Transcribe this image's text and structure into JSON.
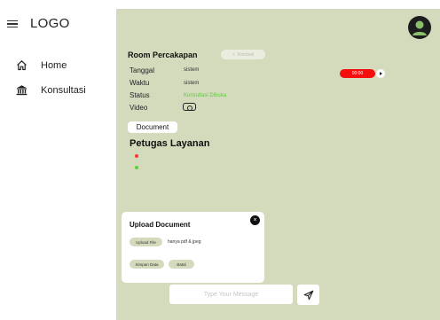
{
  "sidebar": {
    "logo": "LOGO",
    "items": [
      {
        "label": "Home",
        "icon": "home-icon"
      },
      {
        "label": "Konsultasi",
        "icon": "bank-icon"
      }
    ]
  },
  "room": {
    "title": "Room Percakapan",
    "back_label": "Kembali",
    "rows": [
      {
        "label": "Tanggal",
        "value": "sistem"
      },
      {
        "label": "Waktu",
        "value": "sistem"
      },
      {
        "label": "Status",
        "value": "Konsultasi Dibuka"
      },
      {
        "label": "Video",
        "value": ""
      }
    ],
    "timer": "00:00",
    "document_label": "Document",
    "petugas_title": "Petugas Layanan"
  },
  "upload": {
    "title": "Upload Document",
    "upload_file_label": "Upload File",
    "file_hint": "hanya pdf & jpeg",
    "simpan_label": "Simpan Data",
    "batal_label": "Batal",
    "close_glyph": "×"
  },
  "message": {
    "placeholder": "Type Your Message"
  },
  "colors": {
    "panel_bg": "#d3dbbc",
    "status_green": "#5ccf3a",
    "timer_red": "#f40e0e",
    "offline_red": "#ff3333"
  }
}
